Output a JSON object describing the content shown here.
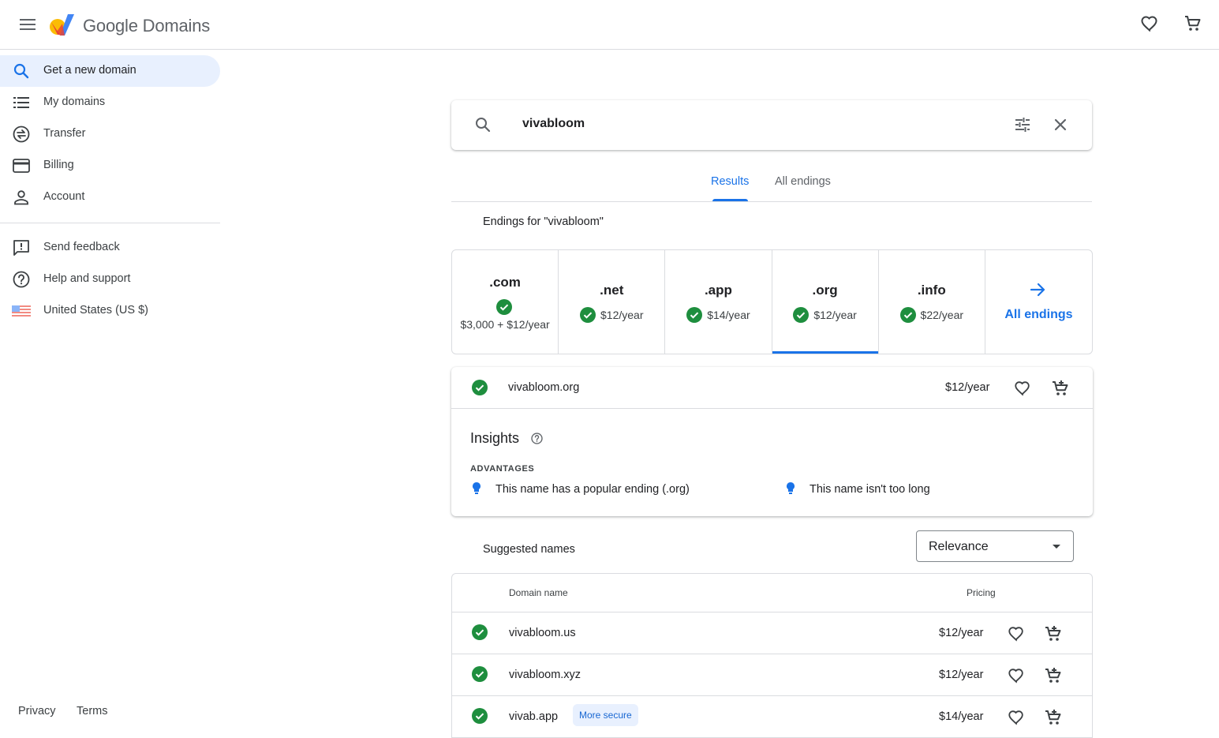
{
  "header": {
    "brand": "Google Domains",
    "menu_icon": "hamburger-menu-icon",
    "favorites_icon": "heart-icon",
    "cart_icon": "shopping-cart-icon"
  },
  "sidebar": {
    "items": [
      {
        "label": "Get a new domain",
        "icon": "search-icon",
        "active": true
      },
      {
        "label": "My domains",
        "icon": "list-icon"
      },
      {
        "label": "Transfer",
        "icon": "transfer-icon"
      },
      {
        "label": "Billing",
        "icon": "credit-card-icon"
      },
      {
        "label": "Account",
        "icon": "person-icon"
      }
    ],
    "secondary": [
      {
        "label": "Send feedback",
        "icon": "feedback-icon"
      },
      {
        "label": "Help and support",
        "icon": "help-icon"
      },
      {
        "label": "United States (US $)",
        "icon": "us-flag-icon"
      }
    ],
    "footer": {
      "privacy": "Privacy",
      "terms": "Terms"
    }
  },
  "search": {
    "query": "vivabloom"
  },
  "tabs": [
    {
      "label": "Results",
      "active": true
    },
    {
      "label": "All endings",
      "active": false
    }
  ],
  "endings_title": "Endings for \"vivabloom\"",
  "endings": [
    {
      "tld": ".com",
      "price": "$3,000 + $12/year",
      "available": true
    },
    {
      "tld": ".net",
      "price": "$12/year",
      "available": true
    },
    {
      "tld": ".app",
      "price": "$14/year",
      "available": true
    },
    {
      "tld": ".org",
      "price": "$12/year",
      "available": true,
      "selected": true
    },
    {
      "tld": ".info",
      "price": "$22/year",
      "available": true
    }
  ],
  "all_endings_link": "All endings",
  "selected_domain": {
    "name": "vivabloom.org",
    "price": "$12/year",
    "insights_title": "Insights",
    "advantages_label": "ADVANTAGES",
    "advantages": [
      "This name has a popular ending (.org)",
      "This name isn't too long"
    ]
  },
  "suggested": {
    "title": "Suggested names",
    "sort_value": "Relevance",
    "columns": {
      "domain": "Domain name",
      "pricing": "Pricing"
    },
    "rows": [
      {
        "name": "vivabloom.us",
        "price": "$12/year",
        "badge": ""
      },
      {
        "name": "vivabloom.xyz",
        "price": "$12/year",
        "badge": ""
      },
      {
        "name": "vivab.app",
        "price": "$14/year",
        "badge": "More secure"
      }
    ]
  },
  "colors": {
    "accent": "#1a73e8",
    "available_green": "#1e8e3e",
    "active_nav_bg": "#e8f0fe"
  }
}
